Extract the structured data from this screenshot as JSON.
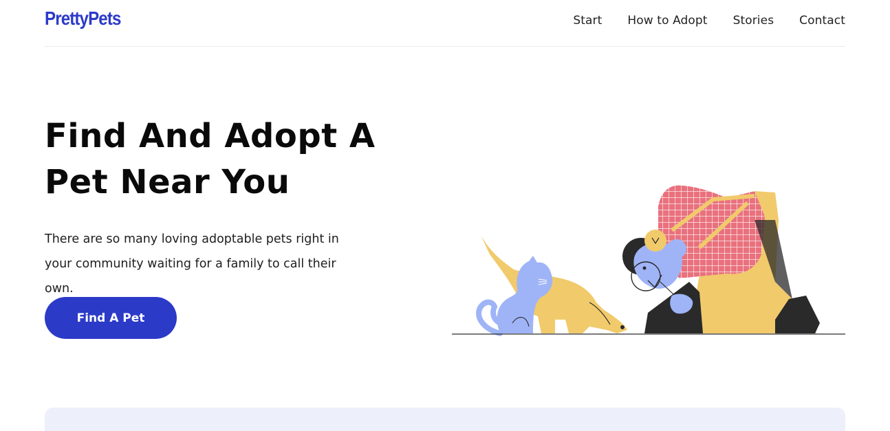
{
  "brand": {
    "name": "PrettyPets",
    "color": "#2c3ac8"
  },
  "nav": {
    "items": [
      {
        "label": "Start"
      },
      {
        "label": "How to Adopt"
      },
      {
        "label": "Stories"
      },
      {
        "label": "Contact"
      }
    ]
  },
  "hero": {
    "title": "Find And Adopt A Pet Near You",
    "description": "There are so many loving adoptable pets right in your community waiting for a family to call their own.",
    "cta_label": "Find A Pet",
    "illustration": "person-walking-dog-with-cat"
  },
  "colors": {
    "accent": "#2c3ac8",
    "panel_background": "#edeffa",
    "pet_yellow": "#f1ca6b",
    "cat_blue": "#9fb4f7",
    "shirt_pink": "#e9717d"
  }
}
